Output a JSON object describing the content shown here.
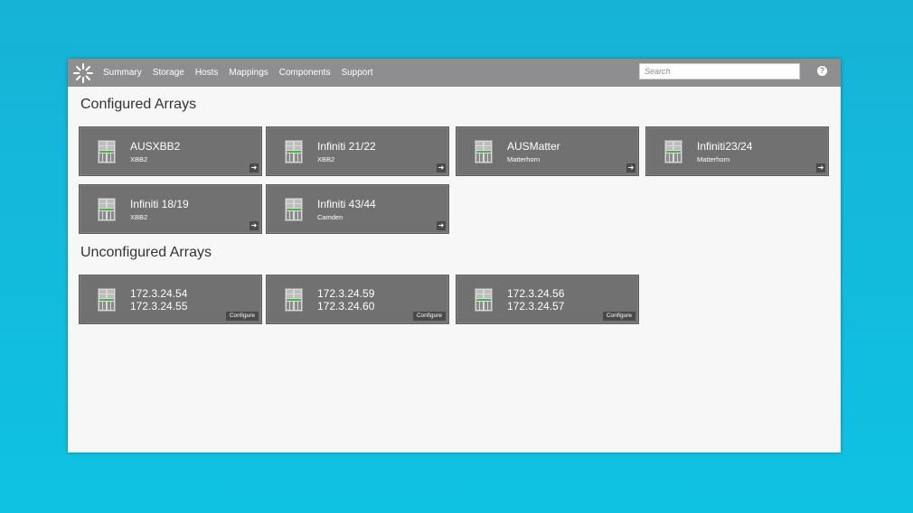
{
  "nav": {
    "items": [
      "Summary",
      "Storage",
      "Hosts",
      "Mappings",
      "Components",
      "Support"
    ]
  },
  "search": {
    "placeholder": "Search"
  },
  "help": {
    "label": "?"
  },
  "sections": {
    "configured_title": "Configured Arrays",
    "unconfigured_title": "Unconfigured Arrays"
  },
  "configured": [
    {
      "name": "AUSXBB2",
      "sub": "XBB2",
      "action_icon": "arrow-right-icon"
    },
    {
      "name": "Infiniti 21/22",
      "sub": "XBB2",
      "action_icon": "arrow-right-icon"
    },
    {
      "name": "AUSMatter",
      "sub": "Matterhorn",
      "action_icon": "arrow-right-icon"
    },
    {
      "name": "Infiniti23/24",
      "sub": "Matterhorn",
      "action_icon": "arrow-right-icon"
    },
    {
      "name": "Infiniti 18/19",
      "sub": "XBB2",
      "action_icon": "arrow-right-icon"
    },
    {
      "name": "Infiniti 43/44",
      "sub": "Camden",
      "action_icon": "arrow-right-icon"
    }
  ],
  "unconfigured": [
    {
      "ip1": "172.3.24.54",
      "ip2": "172.3.24.55",
      "button": "Configure"
    },
    {
      "ip1": "172.3.24.59",
      "ip2": "172.3.24.60",
      "button": "Configure"
    },
    {
      "ip1": "172.3.24.56",
      "ip2": "172.3.24.57",
      "button": "Configure"
    }
  ],
  "colors": {
    "background": "#12bbdc",
    "topbar": "#8e8e8e",
    "tile": "#717171",
    "panel": "#f7f7f7",
    "array_icon_green": "#4caf50"
  }
}
